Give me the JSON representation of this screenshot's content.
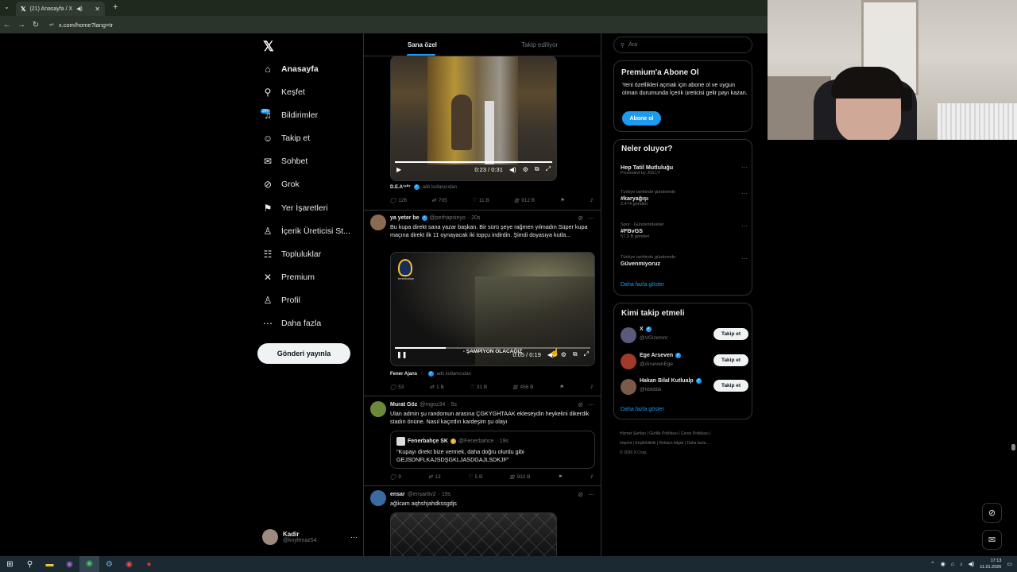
{
  "browser": {
    "tab_title": "(21) Anasayfa / X",
    "url": "x.com/home?lang=tr"
  },
  "taskbar": {
    "time": "17:13",
    "date": "11.01.2026"
  },
  "nav": {
    "items": [
      {
        "label": "Anasayfa",
        "icon": "home-icon",
        "glyph": "⌂"
      },
      {
        "label": "Keşfet",
        "icon": "search-icon",
        "glyph": "⚲"
      },
      {
        "label": "Bildirimler",
        "icon": "bell-icon",
        "glyph": "♫"
      },
      {
        "label": "Takip et",
        "icon": "follow-icon",
        "glyph": "☺"
      },
      {
        "label": "Sohbet",
        "icon": "mail-icon",
        "glyph": "✉"
      },
      {
        "label": "Grok",
        "icon": "grok-icon",
        "glyph": "⊘"
      },
      {
        "label": "Yer İşaretleri",
        "icon": "bookmark-icon",
        "glyph": "⚑"
      },
      {
        "label": "İçerik Üreticisi St...",
        "icon": "creator-icon",
        "glyph": "♙"
      },
      {
        "label": "Topluluklar",
        "icon": "communities-icon",
        "glyph": "☷"
      },
      {
        "label": "Premium",
        "icon": "x-premium-icon",
        "glyph": "✕"
      },
      {
        "label": "Profil",
        "icon": "profile-icon",
        "glyph": "♙"
      },
      {
        "label": "Daha fazla",
        "icon": "more-icon",
        "glyph": "⋯"
      }
    ],
    "notification_badge": "20+",
    "post_button": "Gönderi yayınla",
    "account": {
      "name": "Kadir",
      "handle": "@knyltmaz54"
    }
  },
  "timeline": {
    "tabs": [
      "Sana özel",
      "Takip ediliyor"
    ],
    "tweet1": {
      "video_time": "0:23 / 0:31",
      "video_progress_pct": 100,
      "source_name": "D.E.A¹⁹⁰⁷",
      "source_suffix": "adlı kullanıcıdan",
      "replies": "126",
      "retweets": "705",
      "likes": "11 B",
      "views": "912 B"
    },
    "tweet2": {
      "name": "ya yeter be",
      "handle": "@perhapsinyo",
      "time": "· 20s",
      "text": "Bu kupa direkt sana yazar başkan. Bir sürü şeye rağmen yılmadın Süper kupa maçına direkt ilk 11 oynayacak iki topçu indirdin. Şimdi doyasıya kutla...",
      "video_caption": "- ŞAMPİYON OLACAĞIZ",
      "video_time": "0:05 / 0:19",
      "video_progress_pct": 26,
      "logo_tag": "fenerbahçe",
      "source_name": "Fener Ajans",
      "source_suffix": "adlı kullanıcıdan",
      "replies": "53",
      "retweets": "1 B",
      "likes": "31 B",
      "views": "456 B"
    },
    "tweet3": {
      "name": "Murat Göz",
      "handle": "@mgoz34",
      "time": "· 5s",
      "text": "Ulan admin şu randomun arasına ÇGKYGHTAAK ekleseydin heykelini dikerdik stadın önüne. Nasıl kaçırdın kardeşim şu olayı",
      "quote_name": "Fenerbahçe SK",
      "quote_handle": "@Fenerbahce",
      "quote_time": "· 19s",
      "quote_text": "\"Kupayı direkt bize vermek, daha doğru olurdu gibi GEJSDNFLKAJSDŞGKLJASDGAJLSDKJF\"",
      "replies": "9",
      "retweets": "13",
      "likes": "5 B",
      "views": "932 B"
    },
    "tweet4": {
      "name": "ensar",
      "handle": "@ensar8v2",
      "time": "· 19s",
      "text": "ağlicam aqhshjahdkssgdjs"
    }
  },
  "sidebar": {
    "search_placeholder": "Ara",
    "premium": {
      "title": "Premium'a Abone Ol",
      "text": "Yeni özellikleri açmak için abone ol ve uygun olman durumunda İçerik üreticisi gelir payı kazan.",
      "button": "Abone ol"
    },
    "trends": {
      "title": "Neler oluyor?",
      "items": [
        {
          "context": "",
          "title": "Hep Tatil Mutluluğu",
          "count": "Promoted by JOLLY"
        },
        {
          "context": "Türkiye tarihinde gündemde",
          "title": "#karyağışı",
          "count": "2.474 gönderi"
        },
        {
          "context": "Spor · Gündemdekiler",
          "title": "#FBvGS",
          "count": "57,3 B gönderi"
        },
        {
          "context": "Türkiye tarihinde gündemde",
          "title": "Güvenmiyoruz",
          "count": ""
        }
      ],
      "show_more": "Daha fazla göster"
    },
    "who_to_follow": {
      "title": "Kimi takip etmeli",
      "users": [
        {
          "name": "X",
          "handle": "@VGizemnr",
          "button": "Takip et"
        },
        {
          "name": "Ege Arseven",
          "handle": "@ArsevenEge",
          "button": "Takip et"
        },
        {
          "name": "Hakan Bilal Kutlualp",
          "handle": "@hbkttbk",
          "button": "Takip et"
        }
      ],
      "show_more": "Daha fazla göster"
    },
    "footer": {
      "line1": "Hizmet Şartları  |  Gizlilik Politikası  |  Çerez Politikası  |",
      "line2": "Imprint  |  Erişilebilirlik  |  Reklam bilgisi  |  Daha fazla ...",
      "line3": "© 2026 X Corp."
    }
  },
  "colors": {
    "accent": "#1d9bf0",
    "background": "#000000",
    "border": "#2f3336",
    "muted": "#71767b"
  }
}
